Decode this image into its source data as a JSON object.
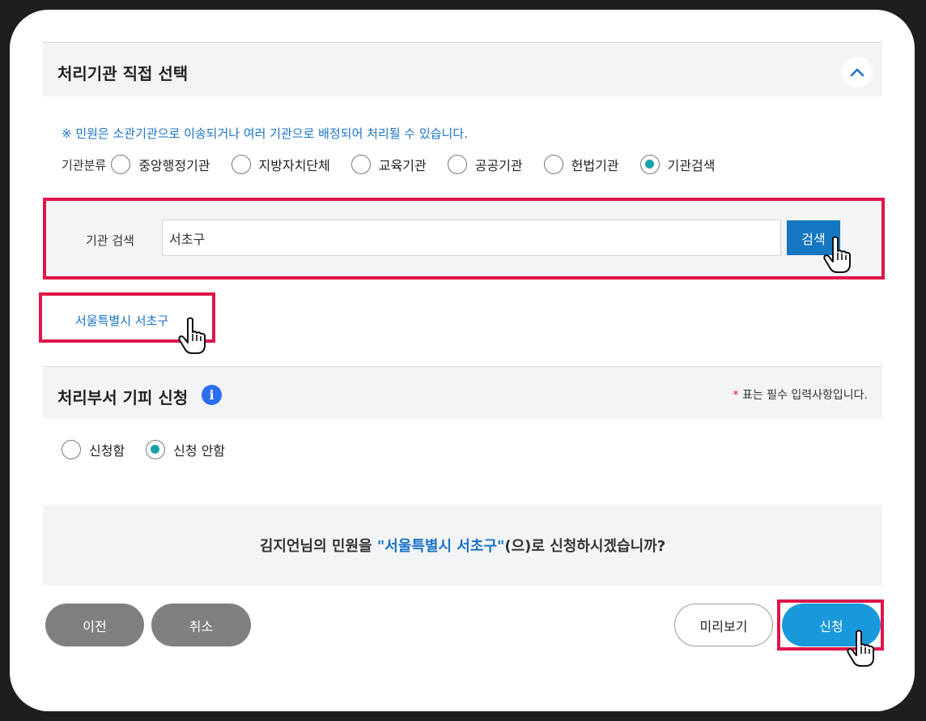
{
  "section1": {
    "title": "처리기관 직접 선택",
    "notice": "※ 민원은 소관기관으로 이송되거나 여러 기관으로 배정되어 처리될 수 있습니다.",
    "category_label": "기관분류",
    "categories": [
      {
        "label": "중앙행정기관",
        "selected": false
      },
      {
        "label": "지방자치단체",
        "selected": false
      },
      {
        "label": "교육기관",
        "selected": false
      },
      {
        "label": "공공기관",
        "selected": false
      },
      {
        "label": "헌법기관",
        "selected": false
      },
      {
        "label": "기관검색",
        "selected": true
      }
    ]
  },
  "search": {
    "label": "기관 검색",
    "value": "서초구",
    "button_label": "검색"
  },
  "result": {
    "org_name": "서울특별시 서초구"
  },
  "section2": {
    "title": "처리부서 기피 신청",
    "required_star": "*",
    "required_note": " 표는 필수 입력사항입니다.",
    "options": [
      {
        "label": "신청함",
        "selected": false
      },
      {
        "label": "신청 안함",
        "selected": true
      }
    ]
  },
  "confirm": {
    "prefix": "김지언님의 민원을 ",
    "org_quoted": "\"서울특별시 서초구\"",
    "suffix": "(으)로 신청하시겠습니까?"
  },
  "buttons": {
    "prev": "이전",
    "cancel": "취소",
    "preview": "미리보기",
    "submit": "신청"
  },
  "colors": {
    "accent": "#1a73c8",
    "highlight": "#e0154a",
    "radio_selected": "#16a3a6",
    "submit": "#1a98dc",
    "search_button": "#1577c2"
  }
}
